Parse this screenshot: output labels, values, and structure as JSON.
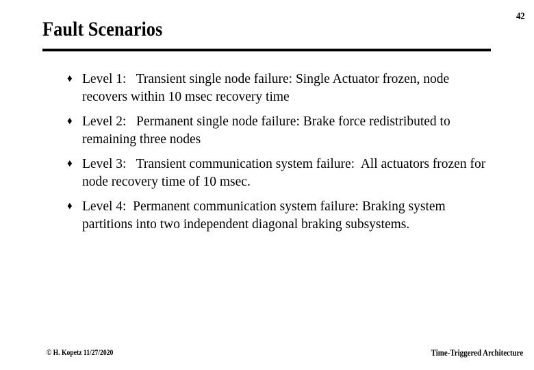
{
  "slide": {
    "page_number": "42",
    "title": "Fault Scenarios",
    "bullet_marker": "♦",
    "bullets": [
      {
        "text": "Level 1:   Transient single node failure: Single Actuator frozen, node recovers within 10 msec recovery time"
      },
      {
        "text": "Level 2:   Permanent single node failure: Brake force redistributed to remaining three nodes"
      },
      {
        "text": "Level 3:   Transient communication system failure:  All actuators frozen for node recovery time of 10 msec."
      },
      {
        "text": "Level 4:  Permanent communication system failure: Braking system partitions into two independent diagonal braking subsystems."
      }
    ],
    "footer": {
      "left": "© H. Kopetz  11/27/2020",
      "right": "Time-Triggered Architecture"
    },
    "colors": {
      "text": "#000000",
      "background": "#ffffff",
      "rule": "#000000"
    }
  }
}
